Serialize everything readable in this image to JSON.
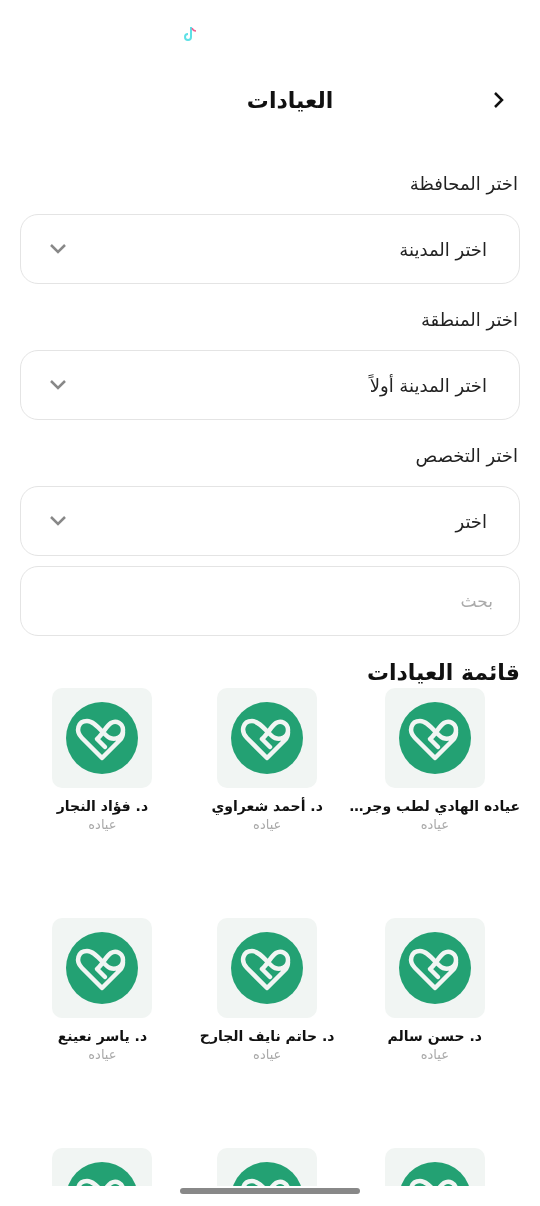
{
  "header": {
    "title": "العيادات"
  },
  "filters": [
    {
      "label": "اختر المحافظة",
      "value": "اختر المدينة"
    },
    {
      "label": "اختر المنطقة",
      "value": "اختر المدينة أولاً"
    },
    {
      "label": "اختر التخصص",
      "value": "اختر"
    }
  ],
  "search": {
    "placeholder": "بحث"
  },
  "list_title": "قائمة العيادات",
  "clinics": [
    {
      "kind": "clinic",
      "name": "عياده الهادي لطب وجر…",
      "type": "عياده"
    },
    {
      "kind": "clinic",
      "name": "د. أحمد شعراوي",
      "type": "عياده"
    },
    {
      "kind": "clinic",
      "name": "د. فؤاد النجار",
      "type": "عياده"
    },
    {
      "kind": "clinic",
      "name": "د. حسن سالم",
      "type": "عياده"
    },
    {
      "kind": "clinic",
      "name": "د. حاتم نايف الجارح",
      "type": "عياده"
    },
    {
      "kind": "clinic",
      "name": "د. ياسر نعينع",
      "type": "عياده"
    },
    {
      "kind": "partial"
    },
    {
      "kind": "partial"
    },
    {
      "kind": "partial"
    }
  ]
}
